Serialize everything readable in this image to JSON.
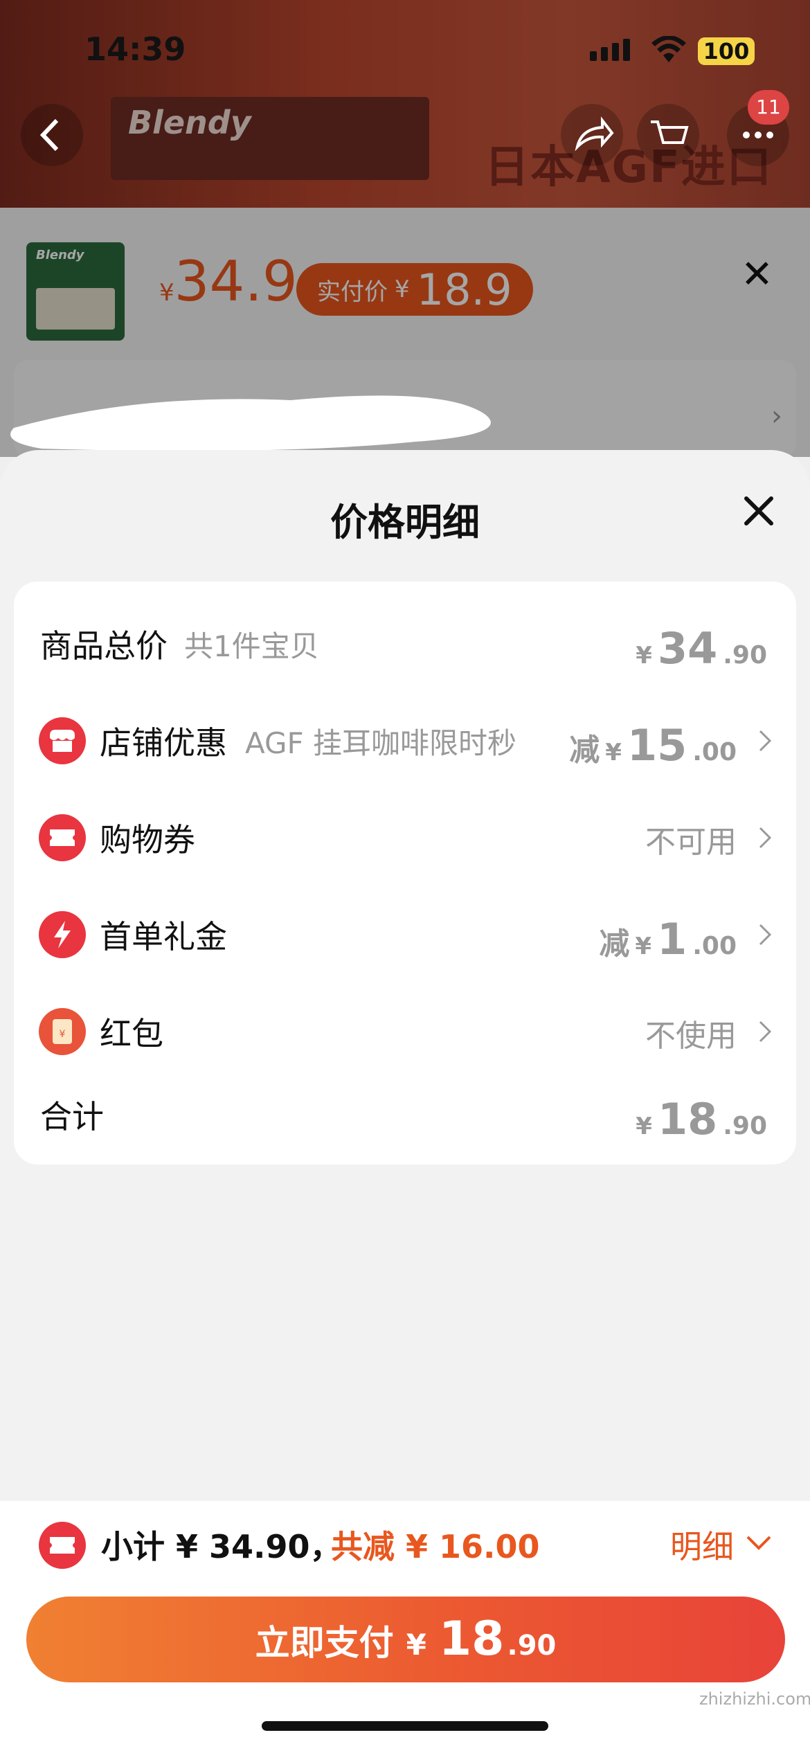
{
  "status_bar": {
    "time": "14:39",
    "battery": "100"
  },
  "background_page": {
    "brand": "Blendy",
    "headline": "日本AGF进口",
    "cart_badge": "11"
  },
  "sku_sheet": {
    "currency": "¥",
    "price": "34.9",
    "actual_label": "实付价",
    "actual_currency": "¥",
    "actual_price": "18.9"
  },
  "price_detail": {
    "title": "价格明细",
    "rows": [
      {
        "label": "商品总价",
        "sub": "共1件宝贝",
        "currency": "¥",
        "int": "34",
        "dec": ".90"
      },
      {
        "label": "店铺优惠",
        "sub": "AGF 挂耳咖啡限时秒",
        "prefix": "减",
        "currency": "¥",
        "int": "15",
        "dec": ".00",
        "icon": "shop-icon"
      },
      {
        "label": "购物券",
        "status": "不可用",
        "icon": "coupon-icon"
      },
      {
        "label": "首单礼金",
        "prefix": "减",
        "currency": "¥",
        "int": "1",
        "dec": ".00",
        "icon": "lightning-icon"
      },
      {
        "label": "红包",
        "status": "不使用",
        "icon": "red-envelope-icon"
      },
      {
        "label": "合计",
        "currency": "¥",
        "int": "18",
        "dec": ".90"
      }
    ]
  },
  "bottom_bar": {
    "subtotal_text": "小计 ¥ 34.90，",
    "discount_text": "共减 ¥ 16.00",
    "detail_label": "明细",
    "pay_label": "立即支付",
    "pay_currency": "¥",
    "pay_int": "18",
    "pay_dec": ".90"
  },
  "watermark": "zhizhizhi.com",
  "colors": {
    "accent": "#e8571e",
    "icon_red": "#e8353f",
    "text": "#111111",
    "muted": "#999999"
  }
}
